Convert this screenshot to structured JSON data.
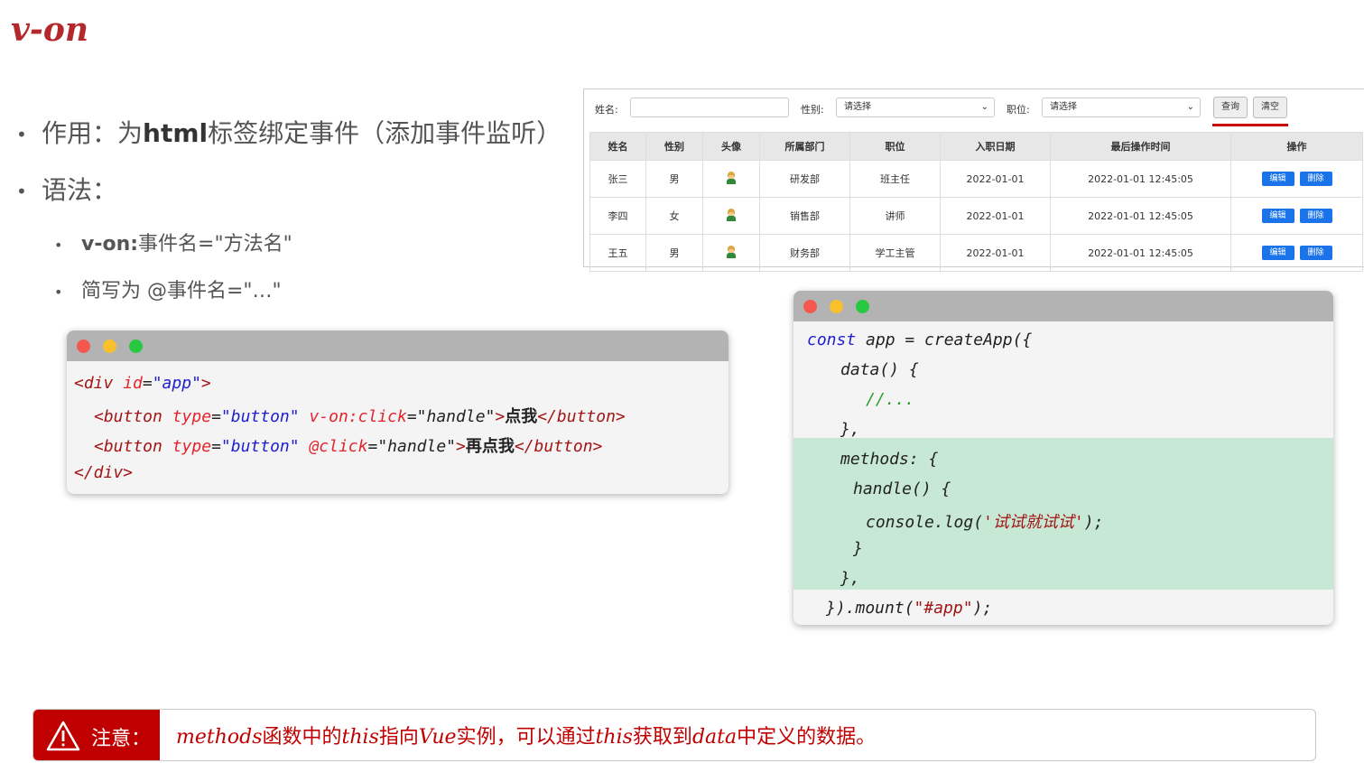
{
  "title": "v-on",
  "bullets": {
    "b1_prefix": "作用：为",
    "b1_bold": "html",
    "b1_suffix": "标签绑定事件（添加事件监听）",
    "b2": "语法：",
    "b3_prefix": "v-on:",
    "b3_suffix": "事件名=\"方法名\"",
    "b4": "简写为  @事件名=\"…\""
  },
  "html_code": {
    "line1": {
      "open": "<div ",
      "attr": "id",
      "eq": "=",
      "val": "\"app\"",
      "close": ">"
    },
    "line2": {
      "open": "<button ",
      "attr1": "type",
      "eq1": "=",
      "val1": "\"button\"",
      "attr2": " v-on:click",
      "eq2": "=",
      "val2": "\"handle\"",
      "gt": ">",
      "text": "点我",
      "close": "</button>"
    },
    "line3": {
      "open": "<button ",
      "attr1": "type",
      "eq1": "=",
      "val1": "\"button\"",
      "attr2": " @click",
      "eq2": "=",
      "val2": "\"handle\"",
      "gt": ">",
      "text": "再点我",
      "close": "</button>"
    },
    "line4": "</div>"
  },
  "js_code": {
    "l1_kw": "const",
    "l1_rest": " app = createApp({",
    "l2": "data() {",
    "l3": "//...",
    "l4": "},",
    "l5": "methods: {",
    "l6": "handle() {",
    "l7_a": "console.log(",
    "l7_b": "'试试就试试'",
    "l7_c": ");",
    "l8": "}",
    "l9": "},",
    "l10_a": "}).mount(",
    "l10_b": "\"#app\"",
    "l10_c": ");"
  },
  "table_panel": {
    "name_label": "姓名:",
    "name_value": "",
    "gender_label": "性别:",
    "gender_value": "请选择",
    "position_label": "职位:",
    "position_value": "请选择",
    "query_button": "查询",
    "clear_button": "清空",
    "headers": [
      "姓名",
      "性别",
      "头像",
      "所属部门",
      "职位",
      "入职日期",
      "最后操作时间",
      "操作"
    ],
    "rows": [
      {
        "name": "张三",
        "gender": "男",
        "dept": "研发部",
        "position": "班主任",
        "date": "2022-01-01",
        "updated": "2022-01-01 12:45:05"
      },
      {
        "name": "李四",
        "gender": "女",
        "dept": "销售部",
        "position": "讲师",
        "date": "2022-01-01",
        "updated": "2022-01-01 12:45:05"
      },
      {
        "name": "王五",
        "gender": "男",
        "dept": "财务部",
        "position": "学工主管",
        "date": "2022-01-01",
        "updated": "2022-01-01 12:45:05"
      }
    ],
    "edit_label": "编辑",
    "delete_label": "删除"
  },
  "note": {
    "label": "注意：",
    "p1": "methods",
    "p2": "函数中的",
    "p3": "this",
    "p4": "指向",
    "p5": "Vue",
    "p6": "实例，可以通过",
    "p7": "this",
    "p8": "获取到",
    "p9": "data",
    "p10": "中定义的数据。"
  },
  "colors": {
    "accent": "#c00000",
    "code_highlight": "#c8e8d6",
    "link_button": "#1a73e8"
  },
  "icons": [
    "warning-icon",
    "avatar-icon",
    "window-close-dot",
    "window-minimize-dot",
    "window-maximize-dot",
    "chevron-down-icon"
  ]
}
